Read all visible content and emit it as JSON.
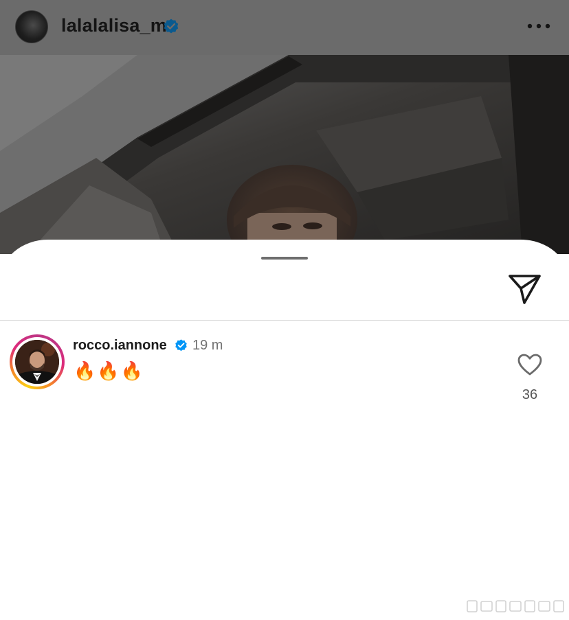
{
  "post": {
    "username": "lalalalisa_m",
    "verified": true,
    "more_icon": "more-horizontal-icon"
  },
  "sheet": {
    "share_icon": "paper-plane-icon"
  },
  "comment": {
    "username": "rocco.iannone",
    "verified": true,
    "time": "19 m",
    "text": "🔥🔥🔥",
    "like_icon": "heart-outline-icon",
    "like_count": "36"
  },
  "colors": {
    "verified_blue": "#0095f6",
    "text_primary": "#1c1c1c",
    "text_secondary": "#737373",
    "divider": "#dbdbdb",
    "dim_overlay": "#6b6b6b"
  }
}
